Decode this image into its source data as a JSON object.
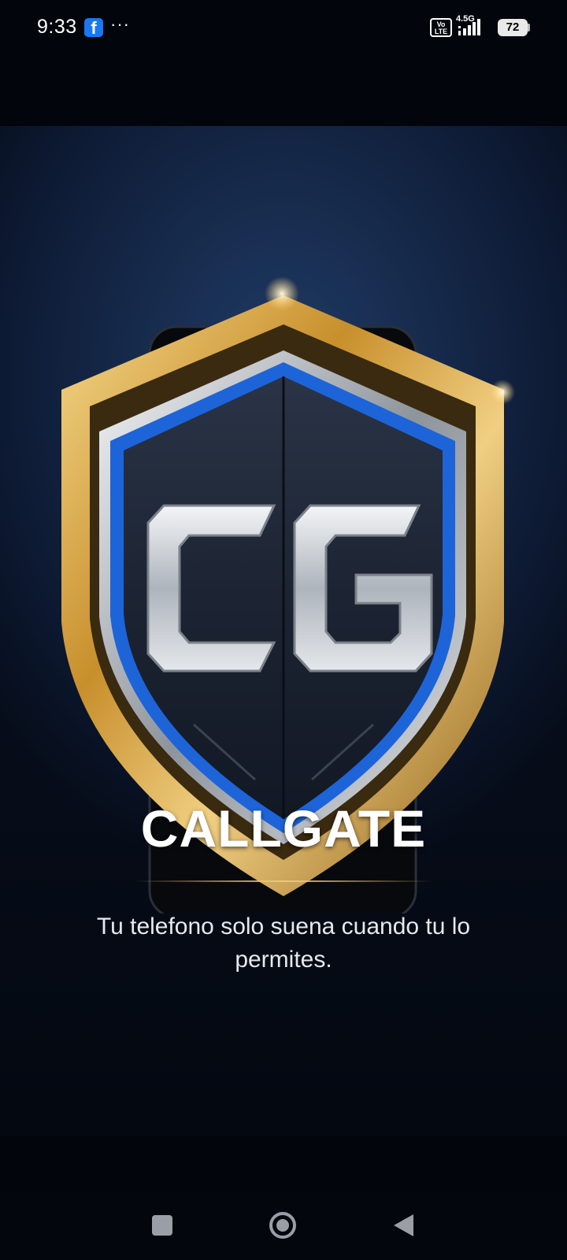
{
  "status_bar": {
    "time": "9:33",
    "notification_icons": [
      "facebook-icon",
      "more-dots-icon"
    ],
    "volte_label": "Vo LTE",
    "network_type": "4.5G",
    "battery_level": "72"
  },
  "splash": {
    "logo_monogram": "CG",
    "app_name": "CALLGATE",
    "tagline": "Tu telefono solo suena cuando tu lo permites.",
    "colors": {
      "background": "#16294a",
      "shield_gold": "#d8a94c",
      "shield_blue": "#1d64d8",
      "letters_silver": "#d9dde2"
    }
  },
  "navigation": {
    "buttons": [
      "recents-button",
      "home-button",
      "back-button"
    ]
  }
}
